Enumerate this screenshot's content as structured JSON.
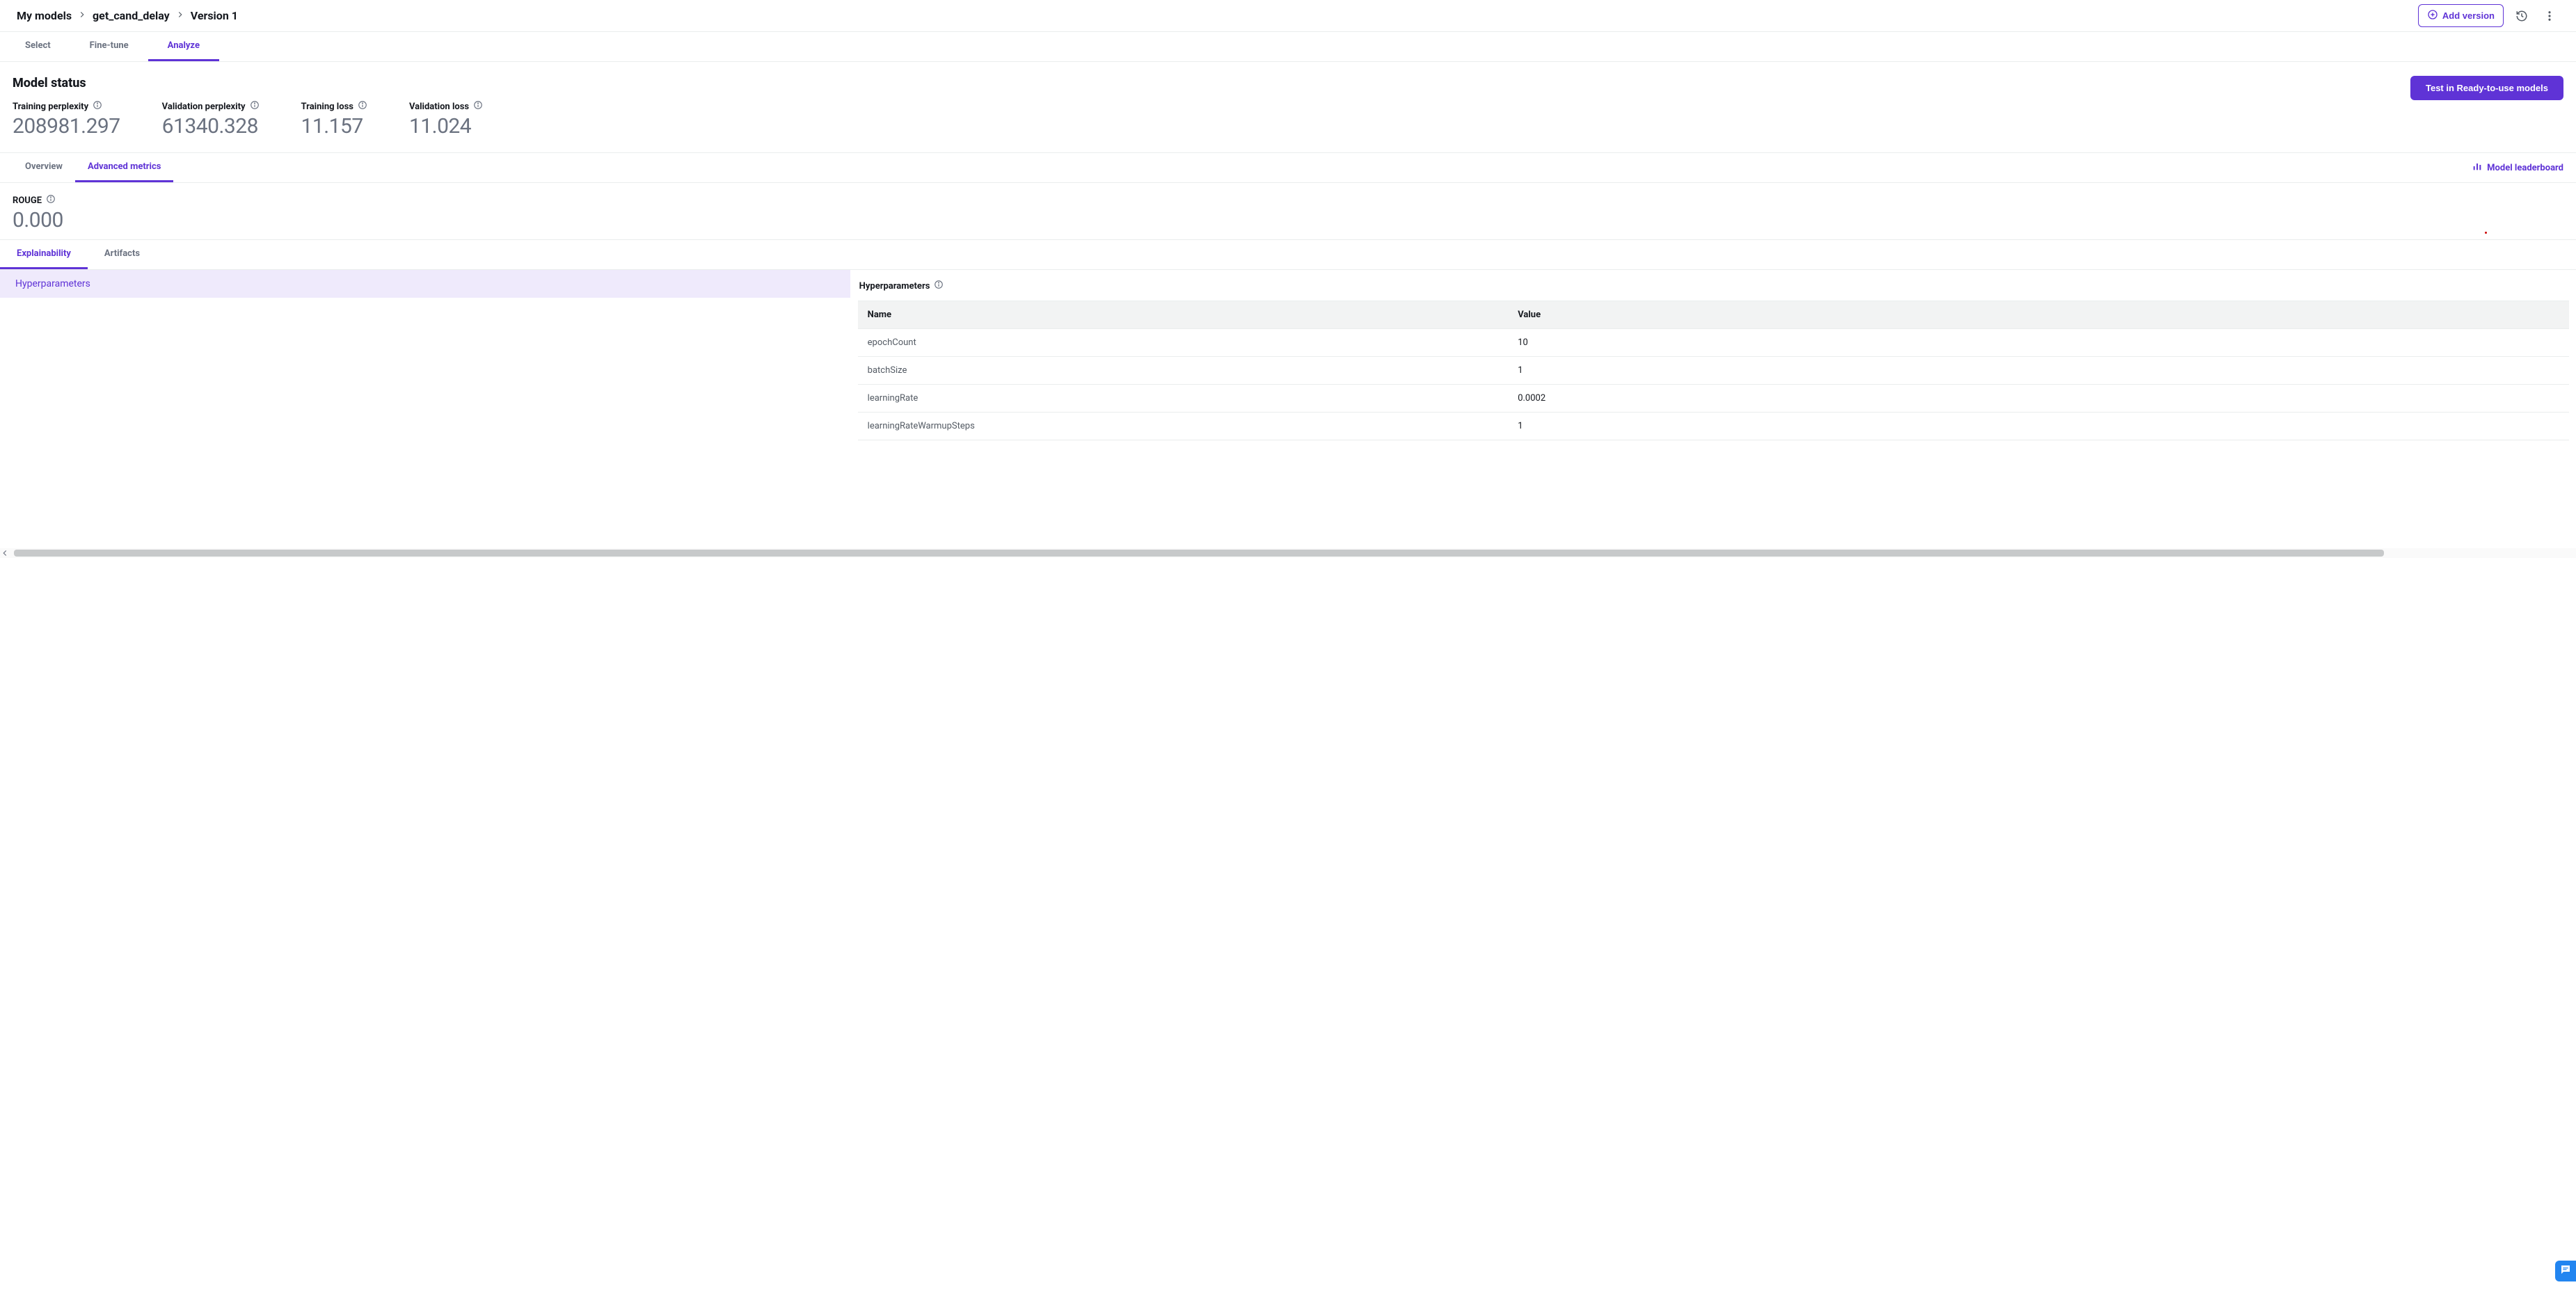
{
  "breadcrumbs": [
    "My models",
    "get_cand_delay",
    "Version 1"
  ],
  "topbar_actions": {
    "add_version": "Add version"
  },
  "primary_tabs": [
    "Select",
    "Fine-tune",
    "Analyze"
  ],
  "primary_active_index": 2,
  "model_status": {
    "title": "Model status",
    "metrics": [
      {
        "label": "Training perplexity",
        "value": "208981.297"
      },
      {
        "label": "Validation perplexity",
        "value": "61340.328"
      },
      {
        "label": "Training loss",
        "value": "11.157"
      },
      {
        "label": "Validation loss",
        "value": "11.024"
      }
    ],
    "cta": "Test in Ready-to-use models"
  },
  "secondary_tabs": [
    "Overview",
    "Advanced metrics"
  ],
  "secondary_active_index": 1,
  "right_link": "Model leaderboard",
  "rouge": {
    "label": "ROUGE",
    "value": "0.000"
  },
  "tertiary_tabs": [
    "Explainability",
    "Artifacts"
  ],
  "tertiary_active_index": 0,
  "left_nav": {
    "item": "Hyperparameters"
  },
  "hyperparameters": {
    "title": "Hyperparameters",
    "columns": [
      "Name",
      "Value"
    ],
    "rows": [
      {
        "name": "epochCount",
        "value": "10"
      },
      {
        "name": "batchSize",
        "value": "1"
      },
      {
        "name": "learningRate",
        "value": "0.0002"
      },
      {
        "name": "learningRateWarmupSteps",
        "value": "1"
      }
    ]
  }
}
